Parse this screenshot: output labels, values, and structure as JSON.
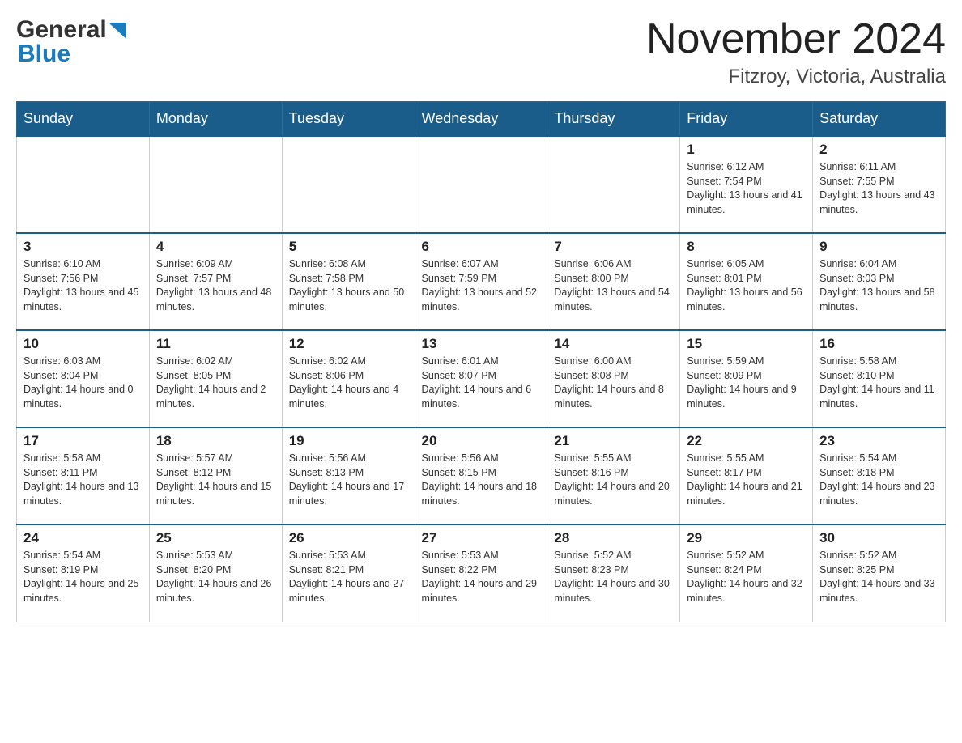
{
  "header": {
    "month_title": "November 2024",
    "location": "Fitzroy, Victoria, Australia",
    "logo_general": "General",
    "logo_blue": "Blue"
  },
  "weekdays": [
    "Sunday",
    "Monday",
    "Tuesday",
    "Wednesday",
    "Thursday",
    "Friday",
    "Saturday"
  ],
  "weeks": [
    {
      "days": [
        {
          "number": "",
          "info": "",
          "empty": true
        },
        {
          "number": "",
          "info": "",
          "empty": true
        },
        {
          "number": "",
          "info": "",
          "empty": true
        },
        {
          "number": "",
          "info": "",
          "empty": true
        },
        {
          "number": "",
          "info": "",
          "empty": true
        },
        {
          "number": "1",
          "info": "Sunrise: 6:12 AM\nSunset: 7:54 PM\nDaylight: 13 hours and 41 minutes.",
          "empty": false
        },
        {
          "number": "2",
          "info": "Sunrise: 6:11 AM\nSunset: 7:55 PM\nDaylight: 13 hours and 43 minutes.",
          "empty": false
        }
      ]
    },
    {
      "days": [
        {
          "number": "3",
          "info": "Sunrise: 6:10 AM\nSunset: 7:56 PM\nDaylight: 13 hours and 45 minutes.",
          "empty": false
        },
        {
          "number": "4",
          "info": "Sunrise: 6:09 AM\nSunset: 7:57 PM\nDaylight: 13 hours and 48 minutes.",
          "empty": false
        },
        {
          "number": "5",
          "info": "Sunrise: 6:08 AM\nSunset: 7:58 PM\nDaylight: 13 hours and 50 minutes.",
          "empty": false
        },
        {
          "number": "6",
          "info": "Sunrise: 6:07 AM\nSunset: 7:59 PM\nDaylight: 13 hours and 52 minutes.",
          "empty": false
        },
        {
          "number": "7",
          "info": "Sunrise: 6:06 AM\nSunset: 8:00 PM\nDaylight: 13 hours and 54 minutes.",
          "empty": false
        },
        {
          "number": "8",
          "info": "Sunrise: 6:05 AM\nSunset: 8:01 PM\nDaylight: 13 hours and 56 minutes.",
          "empty": false
        },
        {
          "number": "9",
          "info": "Sunrise: 6:04 AM\nSunset: 8:03 PM\nDaylight: 13 hours and 58 minutes.",
          "empty": false
        }
      ]
    },
    {
      "days": [
        {
          "number": "10",
          "info": "Sunrise: 6:03 AM\nSunset: 8:04 PM\nDaylight: 14 hours and 0 minutes.",
          "empty": false
        },
        {
          "number": "11",
          "info": "Sunrise: 6:02 AM\nSunset: 8:05 PM\nDaylight: 14 hours and 2 minutes.",
          "empty": false
        },
        {
          "number": "12",
          "info": "Sunrise: 6:02 AM\nSunset: 8:06 PM\nDaylight: 14 hours and 4 minutes.",
          "empty": false
        },
        {
          "number": "13",
          "info": "Sunrise: 6:01 AM\nSunset: 8:07 PM\nDaylight: 14 hours and 6 minutes.",
          "empty": false
        },
        {
          "number": "14",
          "info": "Sunrise: 6:00 AM\nSunset: 8:08 PM\nDaylight: 14 hours and 8 minutes.",
          "empty": false
        },
        {
          "number": "15",
          "info": "Sunrise: 5:59 AM\nSunset: 8:09 PM\nDaylight: 14 hours and 9 minutes.",
          "empty": false
        },
        {
          "number": "16",
          "info": "Sunrise: 5:58 AM\nSunset: 8:10 PM\nDaylight: 14 hours and 11 minutes.",
          "empty": false
        }
      ]
    },
    {
      "days": [
        {
          "number": "17",
          "info": "Sunrise: 5:58 AM\nSunset: 8:11 PM\nDaylight: 14 hours and 13 minutes.",
          "empty": false
        },
        {
          "number": "18",
          "info": "Sunrise: 5:57 AM\nSunset: 8:12 PM\nDaylight: 14 hours and 15 minutes.",
          "empty": false
        },
        {
          "number": "19",
          "info": "Sunrise: 5:56 AM\nSunset: 8:13 PM\nDaylight: 14 hours and 17 minutes.",
          "empty": false
        },
        {
          "number": "20",
          "info": "Sunrise: 5:56 AM\nSunset: 8:15 PM\nDaylight: 14 hours and 18 minutes.",
          "empty": false
        },
        {
          "number": "21",
          "info": "Sunrise: 5:55 AM\nSunset: 8:16 PM\nDaylight: 14 hours and 20 minutes.",
          "empty": false
        },
        {
          "number": "22",
          "info": "Sunrise: 5:55 AM\nSunset: 8:17 PM\nDaylight: 14 hours and 21 minutes.",
          "empty": false
        },
        {
          "number": "23",
          "info": "Sunrise: 5:54 AM\nSunset: 8:18 PM\nDaylight: 14 hours and 23 minutes.",
          "empty": false
        }
      ]
    },
    {
      "days": [
        {
          "number": "24",
          "info": "Sunrise: 5:54 AM\nSunset: 8:19 PM\nDaylight: 14 hours and 25 minutes.",
          "empty": false
        },
        {
          "number": "25",
          "info": "Sunrise: 5:53 AM\nSunset: 8:20 PM\nDaylight: 14 hours and 26 minutes.",
          "empty": false
        },
        {
          "number": "26",
          "info": "Sunrise: 5:53 AM\nSunset: 8:21 PM\nDaylight: 14 hours and 27 minutes.",
          "empty": false
        },
        {
          "number": "27",
          "info": "Sunrise: 5:53 AM\nSunset: 8:22 PM\nDaylight: 14 hours and 29 minutes.",
          "empty": false
        },
        {
          "number": "28",
          "info": "Sunrise: 5:52 AM\nSunset: 8:23 PM\nDaylight: 14 hours and 30 minutes.",
          "empty": false
        },
        {
          "number": "29",
          "info": "Sunrise: 5:52 AM\nSunset: 8:24 PM\nDaylight: 14 hours and 32 minutes.",
          "empty": false
        },
        {
          "number": "30",
          "info": "Sunrise: 5:52 AM\nSunset: 8:25 PM\nDaylight: 14 hours and 33 minutes.",
          "empty": false
        }
      ]
    }
  ]
}
